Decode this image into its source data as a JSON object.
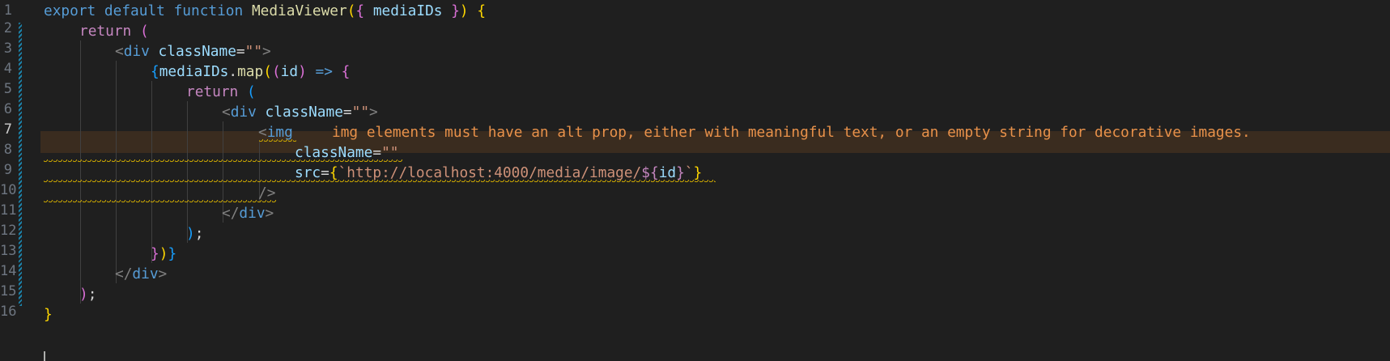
{
  "editor": {
    "line_numbers": [
      "1",
      "2",
      "3",
      "4",
      "5",
      "6",
      "7",
      "8",
      "9",
      "10",
      "11",
      "12",
      "13",
      "14",
      "15",
      "16"
    ],
    "lines": {
      "l1": [
        {
          "t": "export default function "
        },
        {
          "t": "MediaViewer"
        },
        {
          "t": "("
        },
        {
          "t": "{ "
        },
        {
          "t": "mediaIDs"
        },
        {
          "t": " }"
        },
        {
          "t": ")"
        },
        {
          "t": " {"
        }
      ],
      "l2": [
        {
          "t": "return"
        },
        {
          "t": " ("
        }
      ],
      "l3": [
        {
          "t": "<"
        },
        {
          "t": "div"
        },
        {
          "t": " className"
        },
        {
          "t": "="
        },
        {
          "t": "\"\""
        },
        {
          "t": ">"
        }
      ],
      "l4": [
        {
          "t": "{"
        },
        {
          "t": "mediaIDs"
        },
        {
          "t": "."
        },
        {
          "t": "map"
        },
        {
          "t": "("
        },
        {
          "t": "("
        },
        {
          "t": "id"
        },
        {
          "t": ")"
        },
        {
          "t": " => "
        },
        {
          "t": "{"
        }
      ],
      "l5": [
        {
          "t": "return"
        },
        {
          "t": " ("
        }
      ],
      "l6": [
        {
          "t": "<"
        },
        {
          "t": "div"
        },
        {
          "t": " className"
        },
        {
          "t": "="
        },
        {
          "t": "\"\""
        },
        {
          "t": ">"
        }
      ],
      "l7": [
        {
          "t": "<"
        },
        {
          "t": "img"
        }
      ],
      "l8": [
        {
          "t": "className"
        },
        {
          "t": "="
        },
        {
          "t": "\"\""
        }
      ],
      "l9": [
        {
          "t": "src"
        },
        {
          "t": "="
        },
        {
          "t": "{"
        },
        {
          "t": "`"
        },
        {
          "t": "http://localhost:4000/media/image/"
        },
        {
          "t": "${"
        },
        {
          "t": "id"
        },
        {
          "t": "}"
        },
        {
          "t": "`"
        },
        {
          "t": "}"
        }
      ],
      "l10": [
        {
          "t": "/>"
        }
      ],
      "l11": [
        {
          "t": "</"
        },
        {
          "t": "div"
        },
        {
          "t": ">"
        }
      ],
      "l12": [
        {
          "t": ")"
        },
        {
          "t": ";"
        }
      ],
      "l13": [
        {
          "t": "}"
        },
        {
          "t": ")"
        },
        {
          "t": "}"
        }
      ],
      "l14": [
        {
          "t": "</"
        },
        {
          "t": "div"
        },
        {
          "t": ">"
        }
      ],
      "l15": [
        {
          "t": ")"
        },
        {
          "t": ";"
        }
      ],
      "l16": [
        {
          "t": "}"
        }
      ]
    },
    "diagnostic": {
      "message": "img elements must have an alt prop, either with meaningful text, or an empty string for decorative images.",
      "line": "7",
      "severity": "warning",
      "color": "#e8914a"
    },
    "colors": {
      "background": "#1f1f1f",
      "keyword": "#569cd6",
      "control": "#c586c0",
      "function": "#dcdcaa",
      "variable": "#9cdcfe",
      "string": "#ce9178",
      "warning": "#cca700"
    }
  }
}
